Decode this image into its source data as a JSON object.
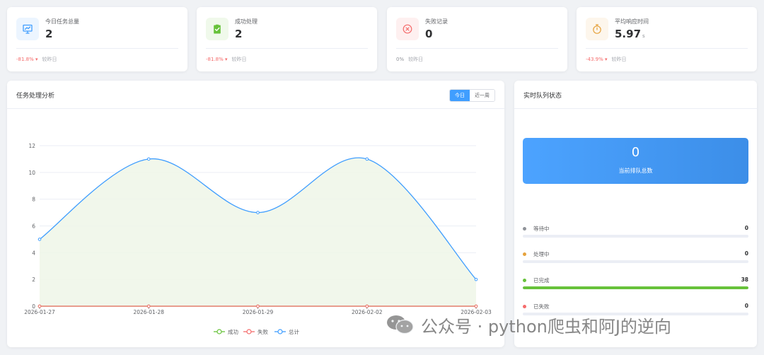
{
  "stats": [
    {
      "label": "今日任务总量",
      "value": "2",
      "unit": "",
      "pct": "-81.8%",
      "trend": "down",
      "compare": "较昨日",
      "icon": "presentation-chart-icon",
      "icon_color": "#409eff",
      "icon_bg": "#ecf5ff"
    },
    {
      "label": "成功处理",
      "value": "2",
      "unit": "",
      "pct": "-81.8%",
      "trend": "down",
      "compare": "较昨日",
      "icon": "clipboard-check-icon",
      "icon_color": "#67c23a",
      "icon_bg": "#f0f9eb"
    },
    {
      "label": "失败记录",
      "value": "0",
      "unit": "",
      "pct": "0%",
      "trend": "flat",
      "compare": "较昨日",
      "icon": "circle-x-icon",
      "icon_color": "#f56c6c",
      "icon_bg": "#fef0f0"
    },
    {
      "label": "平均响应时间",
      "value": "5.97",
      "unit": "s",
      "pct": "-43.9%",
      "trend": "down",
      "compare": "较昨日",
      "icon": "stopwatch-icon",
      "icon_color": "#e6a23c",
      "icon_bg": "#fdf6ec"
    }
  ],
  "chart_panel": {
    "title": "任务处理分析",
    "tabs": [
      {
        "label": "今日",
        "active": true
      },
      {
        "label": "近一周",
        "active": false
      }
    ]
  },
  "chart_data": {
    "type": "line",
    "x": [
      "2026-01-27",
      "2026-01-28",
      "2026-01-29",
      "2026-02-02",
      "2026-02-03"
    ],
    "ylim": [
      0,
      12
    ],
    "yticks": [
      0,
      2,
      4,
      6,
      8,
      10,
      12
    ],
    "grid": true,
    "legend": "bottom-center",
    "series": [
      {
        "name": "成功",
        "values": [
          0,
          0,
          0,
          0,
          0
        ],
        "color": "#67c23a"
      },
      {
        "name": "失败",
        "values": [
          0,
          0,
          0,
          0,
          0
        ],
        "color": "#f56c6c"
      },
      {
        "name": "总计",
        "values": [
          5,
          11,
          7,
          11,
          2
        ],
        "color": "#409eff",
        "area_color": "#eef6e8"
      }
    ]
  },
  "queue": {
    "title": "实时队列状态",
    "total_value": "0",
    "total_label": "当前排队总数",
    "items": [
      {
        "label": "等待中",
        "value": "0",
        "color": "#909399",
        "fraction": 0
      },
      {
        "label": "处理中",
        "value": "0",
        "color": "#e6a23c",
        "fraction": 0
      },
      {
        "label": "已完成",
        "value": "38",
        "color": "#67c23a",
        "fraction": 1
      },
      {
        "label": "已失败",
        "value": "0",
        "color": "#f56c6c",
        "fraction": 0
      }
    ]
  },
  "watermark": {
    "text": "公众号 · python爬虫和阿J的逆向"
  }
}
